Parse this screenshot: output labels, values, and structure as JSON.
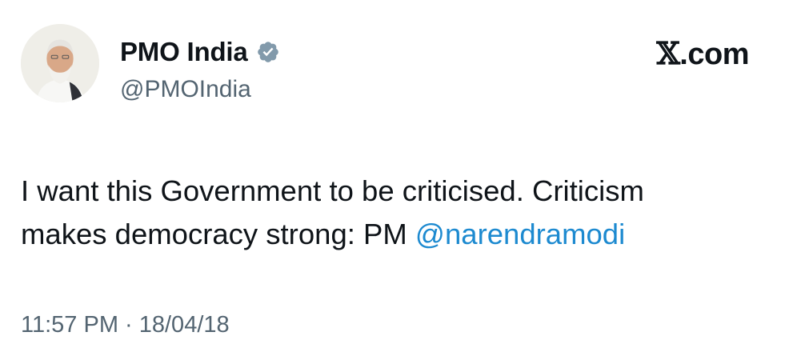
{
  "author": {
    "display_name": "PMO India",
    "handle": "@PMOIndia",
    "verified_badge_icon": "verified-badge-icon",
    "verified_color": "#829aab"
  },
  "site": {
    "x_glyph": "𝕏",
    "domain": ".com"
  },
  "tweet": {
    "text_line1": "I want this Government to be criticised. Criticism",
    "text_line2_prefix": "makes democracy strong: PM ",
    "mention": "@narendramodi",
    "mention_color": "#1d8ad0"
  },
  "meta": {
    "timestamp": "11:57 PM · 18/04/18"
  }
}
